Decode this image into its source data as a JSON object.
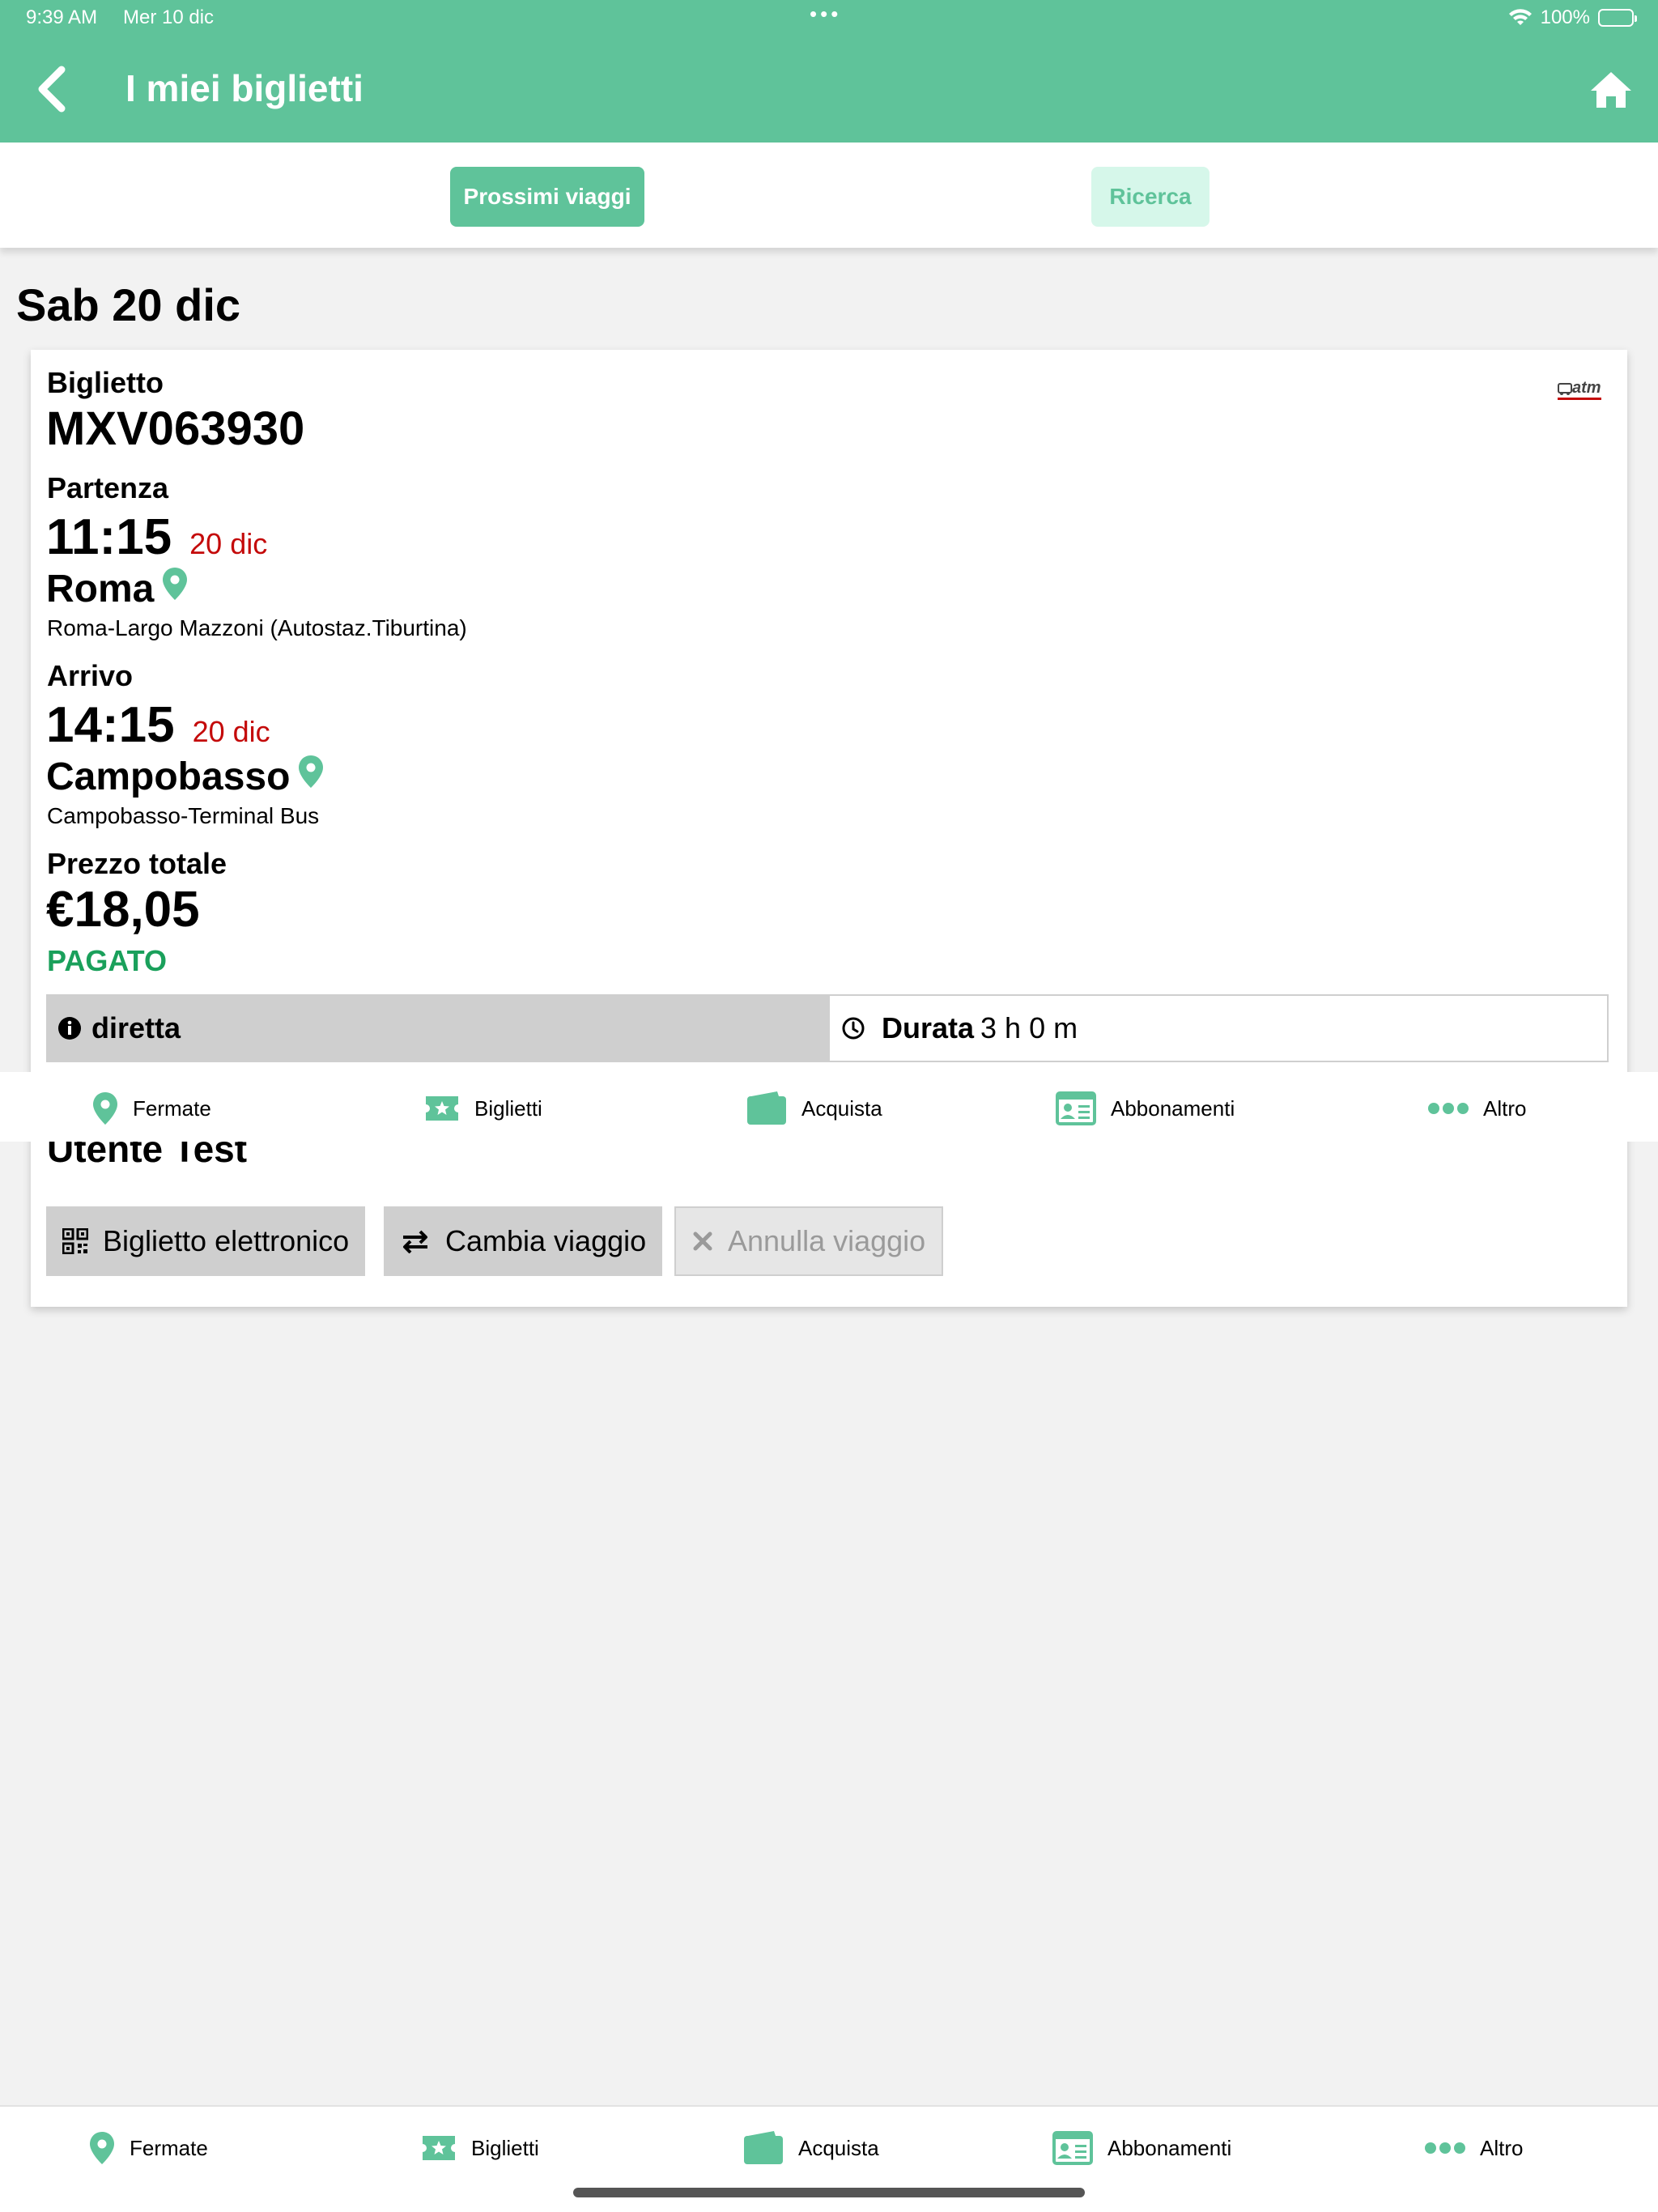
{
  "status_bar": {
    "time": "9:39 AM",
    "date": "Mer 10 dic",
    "battery": "100%"
  },
  "header": {
    "title": "I miei biglietti"
  },
  "tabs": [
    {
      "label": "Prossimi viaggi",
      "active": true
    },
    {
      "label": "Ricerca",
      "active": false
    }
  ],
  "day": "Sab 20 dic",
  "ticket": {
    "ticket_label": "Biglietto",
    "ticket_code": "MXV063930",
    "departure_label": "Partenza",
    "departure_time": "11:15",
    "departure_date": "20 dic",
    "departure_city": "Roma",
    "departure_stop": "Roma-Largo Mazzoni (Autostaz.Tiburtina)",
    "arrival_label": "Arrivo",
    "arrival_time": "14:15",
    "arrival_date": "20 dic",
    "arrival_city": "Campobasso",
    "arrival_stop": "Campobasso-Terminal Bus",
    "price_label": "Prezzo totale",
    "price": "€18,05",
    "payment_status": "PAGATO",
    "route_type": "diretta",
    "duration_label": "Durata",
    "duration_value": "3 h 0 m",
    "passenger": "Utente Test",
    "operator_logo": "atm"
  },
  "actions": {
    "eticket": "Biglietto elettronico",
    "change": "Cambia viaggio",
    "cancel": "Annulla viaggio"
  },
  "tabbar": [
    {
      "label": "Fermate",
      "icon": "map-pin-icon"
    },
    {
      "label": "Biglietti",
      "icon": "ticket-star-icon"
    },
    {
      "label": "Acquista",
      "icon": "wallet-icon"
    },
    {
      "label": "Abbonamenti",
      "icon": "id-card-icon"
    },
    {
      "label": "Altro",
      "icon": "more-dots-icon"
    }
  ],
  "colors": {
    "primary": "#5fc39a",
    "accent_red": "#c40a0a",
    "paid_green": "#1aa05b",
    "light_green": "#d6f7ea"
  }
}
